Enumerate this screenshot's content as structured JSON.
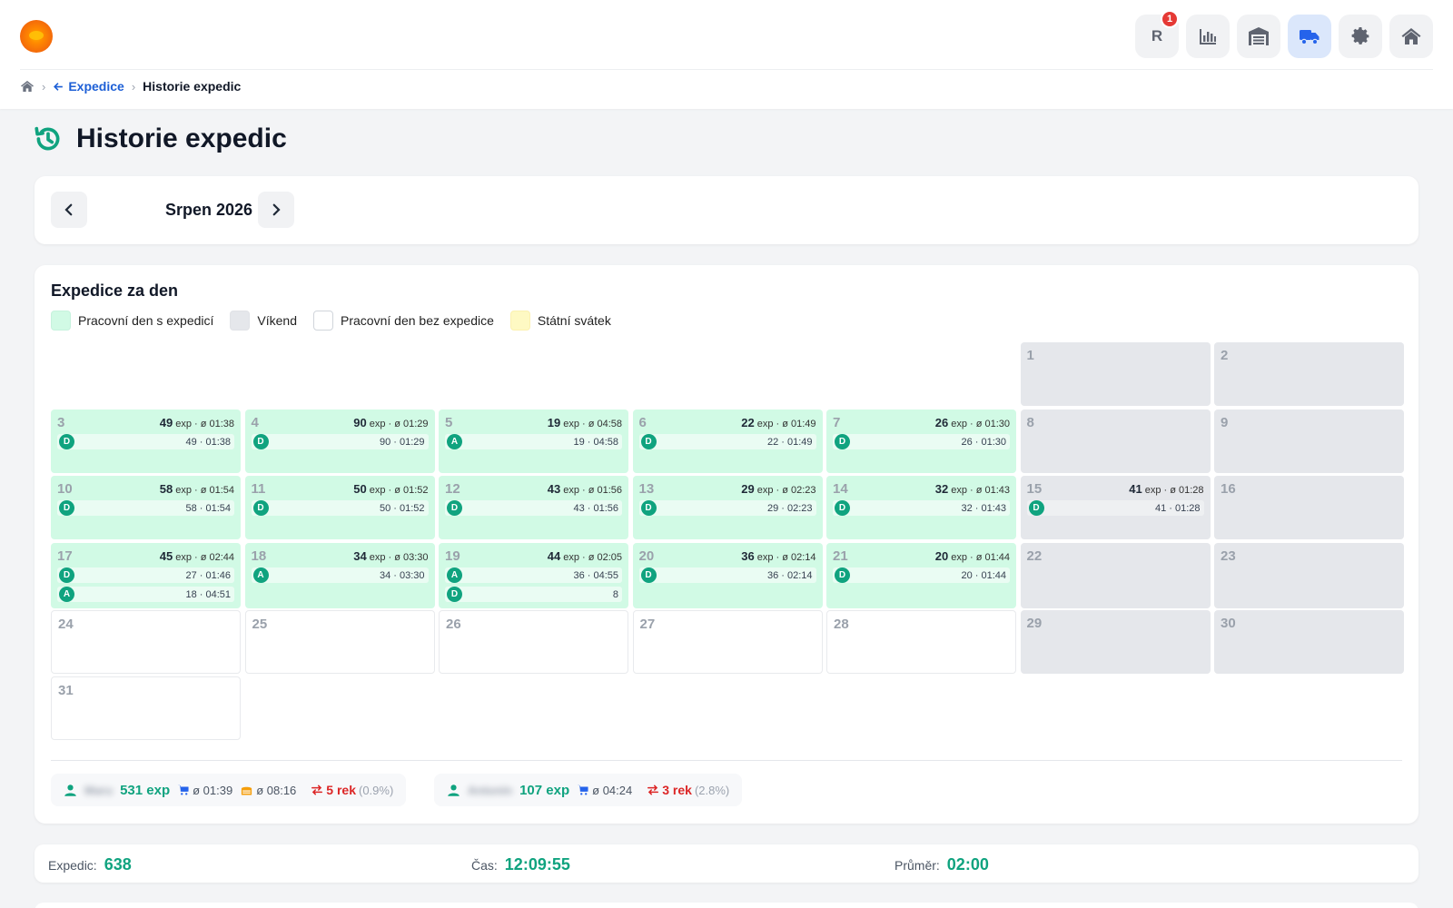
{
  "header": {
    "icons": [
      {
        "name": "reports-r-button",
        "label": "R",
        "badge": "1"
      },
      {
        "name": "chart-icon"
      },
      {
        "name": "warehouse-icon"
      },
      {
        "name": "truck-icon",
        "active": true
      },
      {
        "name": "gear-icon"
      },
      {
        "name": "home-icon"
      }
    ]
  },
  "breadcrumb": {
    "parent": "Expedice",
    "current": "Historie expedic"
  },
  "page": {
    "title": "Historie expedic"
  },
  "month_nav": {
    "label": "Srpen 2026"
  },
  "calendar": {
    "title": "Expedice za den",
    "legend": {
      "work": "Pracovní den s expedicí",
      "weekend": "Víkend",
      "empty": "Pracovní den bez expedice",
      "holiday": "Státní svátek"
    },
    "summary_sep": "exp · ø",
    "days": [
      {
        "n": "1",
        "type": "weekend",
        "col": 5,
        "row": 0
      },
      {
        "n": "2",
        "type": "weekend",
        "col": 6,
        "row": 0
      },
      {
        "n": "3",
        "type": "exp",
        "col": 0,
        "row": 1,
        "count": "49",
        "avg": "01:38",
        "rows": [
          {
            "b": "D",
            "v": "49 · 01:38"
          }
        ]
      },
      {
        "n": "4",
        "type": "exp",
        "col": 1,
        "row": 1,
        "count": "90",
        "avg": "01:29",
        "rows": [
          {
            "b": "D",
            "v": "90 · 01:29"
          }
        ]
      },
      {
        "n": "5",
        "type": "exp",
        "col": 2,
        "row": 1,
        "count": "19",
        "avg": "04:58",
        "rows": [
          {
            "b": "A",
            "v": "19 · 04:58"
          }
        ]
      },
      {
        "n": "6",
        "type": "exp",
        "col": 3,
        "row": 1,
        "count": "22",
        "avg": "01:49",
        "rows": [
          {
            "b": "D",
            "v": "22 · 01:49"
          }
        ]
      },
      {
        "n": "7",
        "type": "exp",
        "col": 4,
        "row": 1,
        "count": "26",
        "avg": "01:30",
        "rows": [
          {
            "b": "D",
            "v": "26 · 01:30"
          }
        ]
      },
      {
        "n": "8",
        "type": "weekend",
        "col": 5,
        "row": 1
      },
      {
        "n": "9",
        "type": "weekend",
        "col": 6,
        "row": 1
      },
      {
        "n": "10",
        "type": "exp",
        "col": 0,
        "row": 2,
        "count": "58",
        "avg": "01:54",
        "rows": [
          {
            "b": "D",
            "v": "58 · 01:54"
          }
        ]
      },
      {
        "n": "11",
        "type": "exp",
        "col": 1,
        "row": 2,
        "count": "50",
        "avg": "01:52",
        "rows": [
          {
            "b": "D",
            "v": "50 · 01:52"
          }
        ]
      },
      {
        "n": "12",
        "type": "exp",
        "col": 2,
        "row": 2,
        "count": "43",
        "avg": "01:56",
        "rows": [
          {
            "b": "D",
            "v": "43 · 01:56"
          }
        ]
      },
      {
        "n": "13",
        "type": "exp",
        "col": 3,
        "row": 2,
        "count": "29",
        "avg": "02:23",
        "rows": [
          {
            "b": "D",
            "v": "29 · 02:23"
          }
        ]
      },
      {
        "n": "14",
        "type": "exp",
        "col": 4,
        "row": 2,
        "count": "32",
        "avg": "01:43",
        "rows": [
          {
            "b": "D",
            "v": "32 · 01:43"
          }
        ]
      },
      {
        "n": "15",
        "type": "weekend",
        "col": 5,
        "row": 2,
        "count": "41",
        "avg": "01:28",
        "rows": [
          {
            "b": "D",
            "v": "41 · 01:28"
          }
        ]
      },
      {
        "n": "16",
        "type": "weekend",
        "col": 6,
        "row": 2
      },
      {
        "n": "17",
        "type": "exp",
        "col": 0,
        "row": 3,
        "count": "45",
        "avg": "02:44",
        "rows": [
          {
            "b": "D",
            "v": "27 · 01:46"
          },
          {
            "b": "A",
            "v": "18 · 04:51"
          }
        ]
      },
      {
        "n": "18",
        "type": "exp",
        "col": 1,
        "row": 3,
        "count": "34",
        "avg": "03:30",
        "rows": [
          {
            "b": "A",
            "v": "34 · 03:30"
          }
        ]
      },
      {
        "n": "19",
        "type": "exp",
        "col": 2,
        "row": 3,
        "count": "44",
        "avg": "02:05",
        "rows": [
          {
            "b": "A",
            "v": "36 · 04:55"
          },
          {
            "b": "D",
            "v": "8"
          }
        ]
      },
      {
        "n": "20",
        "type": "exp",
        "col": 3,
        "row": 3,
        "count": "36",
        "avg": "02:14",
        "rows": [
          {
            "b": "D",
            "v": "36 · 02:14"
          }
        ]
      },
      {
        "n": "21",
        "type": "exp",
        "col": 4,
        "row": 3,
        "count": "20",
        "avg": "01:44",
        "rows": [
          {
            "b": "D",
            "v": "20 · 01:44"
          }
        ]
      },
      {
        "n": "22",
        "type": "weekend",
        "col": 5,
        "row": 3
      },
      {
        "n": "23",
        "type": "weekend",
        "col": 6,
        "row": 3
      },
      {
        "n": "24",
        "type": "empty",
        "col": 0,
        "row": 4
      },
      {
        "n": "25",
        "type": "empty",
        "col": 1,
        "row": 4
      },
      {
        "n": "26",
        "type": "empty",
        "col": 2,
        "row": 4
      },
      {
        "n": "27",
        "type": "empty",
        "col": 3,
        "row": 4
      },
      {
        "n": "28",
        "type": "empty",
        "col": 4,
        "row": 4
      },
      {
        "n": "29",
        "type": "weekend",
        "col": 5,
        "row": 4
      },
      {
        "n": "30",
        "type": "weekend",
        "col": 6,
        "row": 4
      },
      {
        "n": "31",
        "type": "empty",
        "col": 0,
        "row": 5
      }
    ]
  },
  "users": [
    {
      "name": "Maru",
      "exp": "531 exp",
      "cart_avg": "ø 01:39",
      "box_avg": "ø 08:16",
      "rek": "5 rek",
      "pct": "(0.9%)"
    },
    {
      "name": "Antonín",
      "exp": "107 exp",
      "cart_avg": "ø 04:24",
      "rek": "3 rek",
      "pct": "(2.8%)"
    }
  ],
  "stats": {
    "expedic_label": "Expedic:",
    "expedic_value": "638",
    "cas_label": "Čas:",
    "cas_value": "12:09:55",
    "prumer_label": "Průměr:",
    "prumer_value": "02:00"
  },
  "colors": {
    "accent_green": "#10a37f",
    "link_blue": "#1d5fd6",
    "danger_red": "#dc2626",
    "workday": "#d1fae5",
    "weekend": "#e5e7eb",
    "holiday": "#fef9c3"
  }
}
